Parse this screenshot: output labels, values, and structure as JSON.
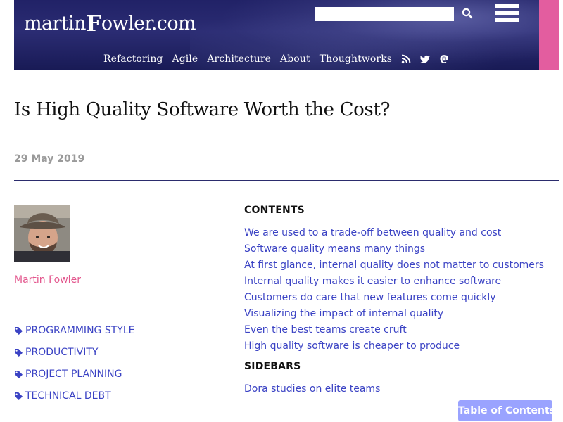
{
  "header": {
    "logo": {
      "prefix": "martin",
      "middle": "F",
      "suffix": "owler.com"
    },
    "search": {
      "placeholder": ""
    },
    "nav": [
      {
        "label": "Refactoring"
      },
      {
        "label": "Agile"
      },
      {
        "label": "Architecture"
      },
      {
        "label": "About"
      },
      {
        "label": "Thoughtworks"
      }
    ],
    "social_icons": [
      "rss-icon",
      "twitter-icon",
      "mastodon-icon"
    ]
  },
  "article": {
    "title": "Is High Quality Software Worth the Cost?",
    "date": "29 May 2019"
  },
  "author": {
    "name": "Martin Fowler",
    "avatar_icon": "author-photo"
  },
  "tags": [
    {
      "label": "PROGRAMMING STYLE"
    },
    {
      "label": "PRODUCTIVITY"
    },
    {
      "label": "PROJECT PLANNING"
    },
    {
      "label": "TECHNICAL DEBT"
    }
  ],
  "contents": {
    "heading": "CONTENTS",
    "items": [
      {
        "label": "We are used to a trade-off between quality and cost"
      },
      {
        "label": "Software quality means many things"
      },
      {
        "label": "At first glance, internal quality does not matter to customers"
      },
      {
        "label": "Internal quality makes it easier to enhance software"
      },
      {
        "label": "Customers do care that new features come quickly"
      },
      {
        "label": "Visualizing the impact of internal quality"
      },
      {
        "label": "Even the best teams create cruft"
      },
      {
        "label": "High quality software is cheaper to produce"
      }
    ]
  },
  "sidebars": {
    "heading": "SIDEBARS",
    "items": [
      {
        "label": "Dora studies on elite teams"
      }
    ]
  },
  "toc_button": {
    "label": "Table of Contents"
  },
  "colors": {
    "header_navy": "#212267",
    "accent_pink": "#e35d9f",
    "link_blue": "#3b43c4",
    "author_pink": "#e3568d",
    "toc_button_blue": "#9aa3ff"
  }
}
